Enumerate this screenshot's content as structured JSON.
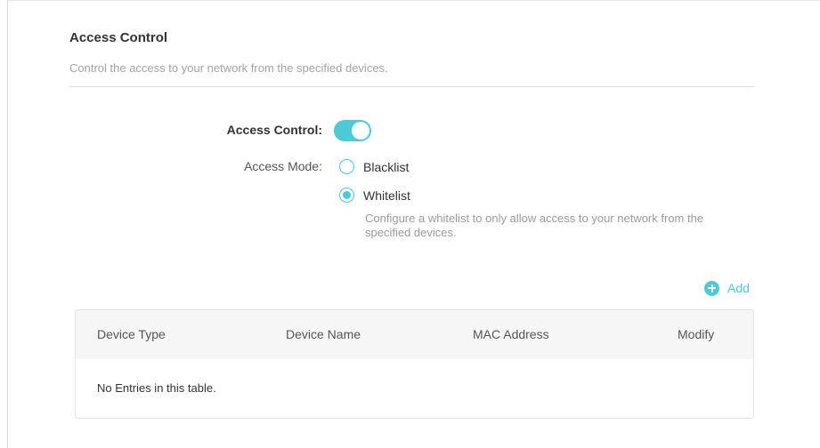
{
  "section": {
    "title": "Access Control",
    "description": "Control the access to your network from the specified devices."
  },
  "form": {
    "access_control_label": "Access Control:",
    "access_control_enabled": true,
    "access_mode_label": "Access Mode:",
    "modes": [
      {
        "label": "Blacklist",
        "checked": false
      },
      {
        "label": "Whitelist",
        "checked": true
      }
    ],
    "hint": "Configure a whitelist to only allow access to your network from the specified devices."
  },
  "toolbar": {
    "add_label": "Add",
    "add_icon": "plus-circle-icon"
  },
  "table": {
    "columns": [
      "Device Type",
      "Device Name",
      "MAC Address",
      "Modify"
    ],
    "rows": [],
    "empty_text": "No Entries in this table."
  },
  "colors": {
    "accent": "#4acbd6",
    "header_bg": "#f6f6f6"
  }
}
